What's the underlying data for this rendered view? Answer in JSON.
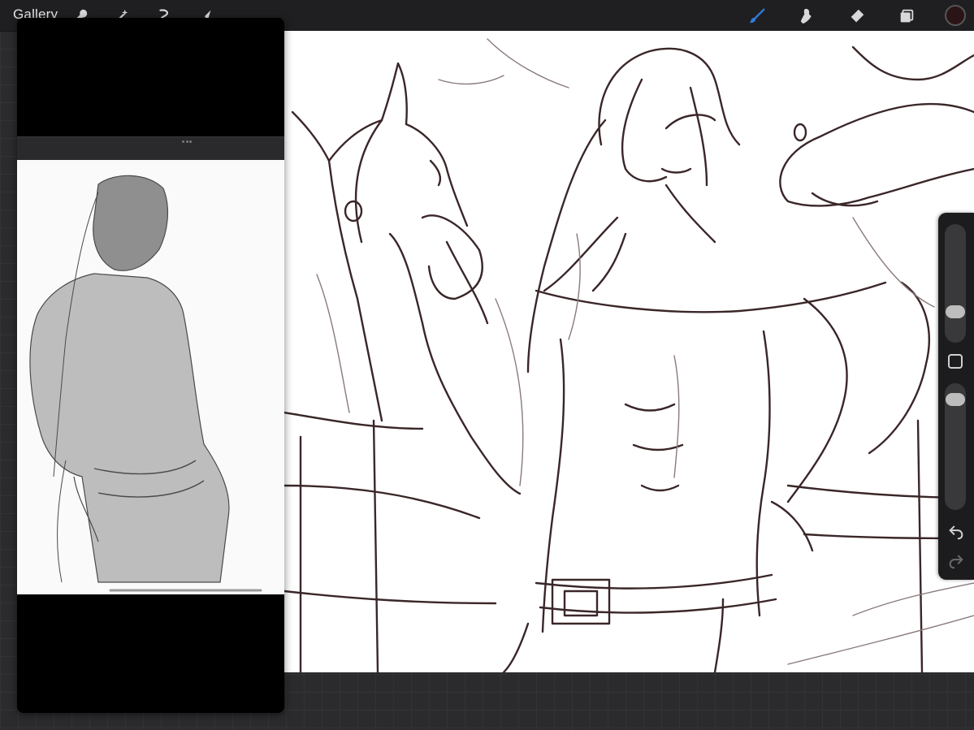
{
  "header": {
    "gallery_label": "Gallery",
    "left_tools": [
      "wrench-icon",
      "magic-wand-icon",
      "selection-icon",
      "transform-arrow-icon"
    ],
    "right_tools": [
      "brush-icon",
      "smudge-icon",
      "eraser-icon",
      "layers-icon"
    ],
    "active_tool": "brush-icon",
    "current_color": "#2b1416",
    "accent_color": "#2f7ad9"
  },
  "sidebar": {
    "brush_size_fraction": 0.22,
    "opacity_fraction": 0.93,
    "buttons": [
      "modify-square-icon",
      "undo-icon",
      "redo-icon"
    ]
  },
  "reference_panel": {
    "icon_names": [
      "panel-resize-handle-icon"
    ]
  },
  "colors": {
    "stroke": "#3a2628",
    "stroke_light": "#8a7a7c",
    "ref_fill": "#bdbdbd",
    "ref_stroke": "#4a4a4a"
  }
}
